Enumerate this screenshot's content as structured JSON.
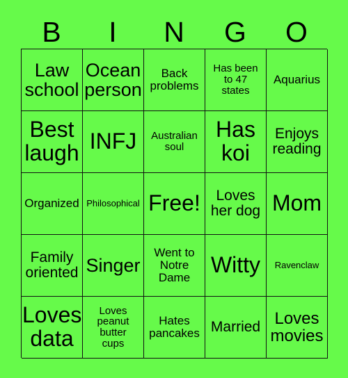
{
  "card": {
    "background_color": "#66fa4a",
    "border_color": "#111111",
    "text_color": "#000000",
    "header_letters": [
      "B",
      "I",
      "N",
      "G",
      "O"
    ],
    "columns": 5,
    "rows": 5,
    "cells": [
      {
        "text": "Law\nschool",
        "size": "fs-xl"
      },
      {
        "text": "Ocean\nperson",
        "size": "fs-xl"
      },
      {
        "text": "Back\nproblems",
        "size": "fs-sm"
      },
      {
        "text": "Has been\nto 47\nstates",
        "size": "fs-xs"
      },
      {
        "text": "Aquarius",
        "size": "fs-sm"
      },
      {
        "text": "Best\nlaugh",
        "size": "fs-xxl"
      },
      {
        "text": "INFJ",
        "size": "fs-xxl"
      },
      {
        "text": "Australian\nsoul",
        "size": "fs-xs"
      },
      {
        "text": "Has\nkoi",
        "size": "fs-xxl"
      },
      {
        "text": "Enjoys\nreading",
        "size": "fs-md"
      },
      {
        "text": "Organized",
        "size": "fs-sm"
      },
      {
        "text": "Philosophical",
        "size": "fs-xxs"
      },
      {
        "text": "Free!",
        "size": "fs-xxl"
      },
      {
        "text": "Loves\nher dog",
        "size": "fs-md"
      },
      {
        "text": "Mom",
        "size": "fs-xxl"
      },
      {
        "text": "Family\noriented",
        "size": "fs-md"
      },
      {
        "text": "Singer",
        "size": "fs-xl"
      },
      {
        "text": "Went to\nNotre\nDame",
        "size": "fs-sm"
      },
      {
        "text": "Witty",
        "size": "fs-xxl"
      },
      {
        "text": "Ravenclaw",
        "size": "fs-xxs"
      },
      {
        "text": "Loves\ndata",
        "size": "fs-xxl"
      },
      {
        "text": "Loves\npeanut\nbutter\ncups",
        "size": "fs-xs"
      },
      {
        "text": "Hates\npancakes",
        "size": "fs-sm"
      },
      {
        "text": "Married",
        "size": "fs-md"
      },
      {
        "text": "Loves\nmovies",
        "size": "fs-lg"
      }
    ]
  }
}
